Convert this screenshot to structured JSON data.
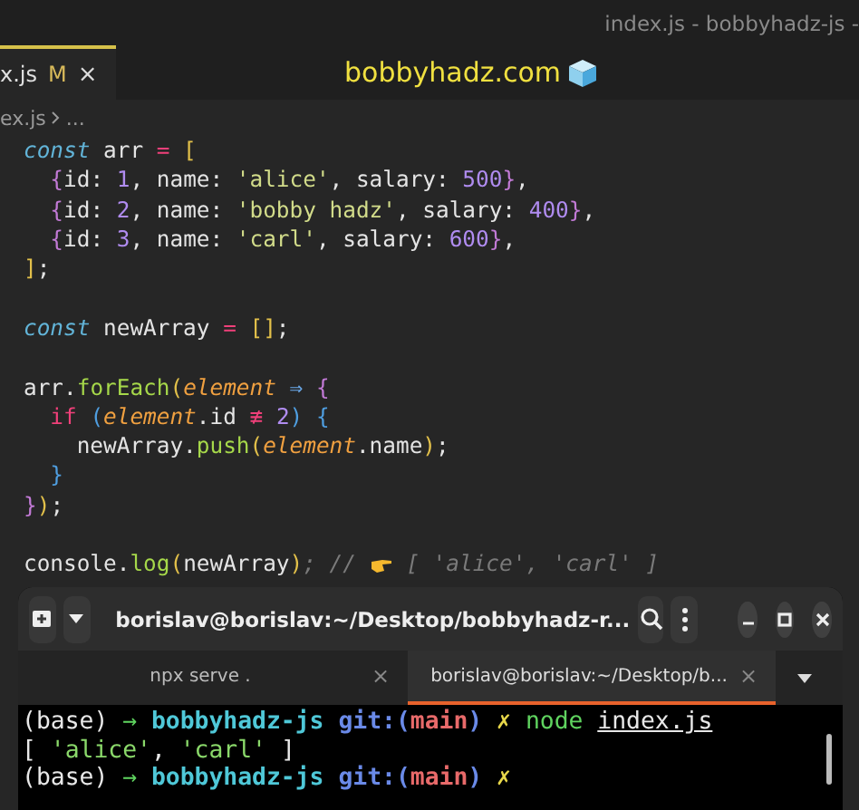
{
  "window": {
    "title": "index.js - bobbyhadz-js -"
  },
  "tabs": [
    {
      "label": "x.js",
      "status": "M",
      "close": "×",
      "selected": true
    }
  ],
  "banner": {
    "text": "bobbyhadz.com"
  },
  "breadcrumb": {
    "file": "ex.js",
    "rest": "..."
  },
  "code": {
    "lines": [
      {
        "kind": "code",
        "tokens": [
          {
            "text": "const",
            "kind": "kw"
          },
          {
            "text": " arr ",
            "kind": "var"
          },
          {
            "text": "=",
            "kind": "op"
          },
          {
            "text": " [",
            "kind": "b1"
          }
        ]
      },
      {
        "kind": "code",
        "tokens": [
          {
            "text": "  {",
            "kind": "b2"
          },
          {
            "text": "id: ",
            "kind": "var"
          },
          {
            "text": "1",
            "kind": "num"
          },
          {
            "text": ", name: ",
            "kind": "var"
          },
          {
            "text": "'alice'",
            "kind": "str"
          },
          {
            "text": ", salary: ",
            "kind": "var"
          },
          {
            "text": "500",
            "kind": "num"
          },
          {
            "text": "}",
            "kind": "b2"
          },
          {
            "text": ",",
            "kind": "var"
          }
        ]
      },
      {
        "kind": "code",
        "tokens": [
          {
            "text": "  {",
            "kind": "b2"
          },
          {
            "text": "id: ",
            "kind": "var"
          },
          {
            "text": "2",
            "kind": "num"
          },
          {
            "text": ", name: ",
            "kind": "var"
          },
          {
            "text": "'bobby hadz'",
            "kind": "str"
          },
          {
            "text": ", salary: ",
            "kind": "var"
          },
          {
            "text": "400",
            "kind": "num"
          },
          {
            "text": "}",
            "kind": "b2"
          },
          {
            "text": ",",
            "kind": "var"
          }
        ]
      },
      {
        "kind": "code",
        "tokens": [
          {
            "text": "  {",
            "kind": "b2"
          },
          {
            "text": "id: ",
            "kind": "var"
          },
          {
            "text": "3",
            "kind": "num"
          },
          {
            "text": ", name: ",
            "kind": "var"
          },
          {
            "text": "'carl'",
            "kind": "str"
          },
          {
            "text": ", salary: ",
            "kind": "var"
          },
          {
            "text": "600",
            "kind": "num"
          },
          {
            "text": "}",
            "kind": "b2"
          },
          {
            "text": ",",
            "kind": "var"
          }
        ]
      },
      {
        "kind": "code",
        "tokens": [
          {
            "text": "]",
            "kind": "b1"
          },
          {
            "text": ";",
            "kind": "var"
          }
        ]
      },
      {
        "kind": "blank"
      },
      {
        "kind": "code",
        "tokens": [
          {
            "text": "const",
            "kind": "kw"
          },
          {
            "text": " newArray ",
            "kind": "var"
          },
          {
            "text": "=",
            "kind": "op"
          },
          {
            "text": " []",
            "kind": "b1"
          },
          {
            "text": ";",
            "kind": "var"
          }
        ]
      },
      {
        "kind": "blank"
      },
      {
        "kind": "code",
        "tokens": [
          {
            "text": "arr.",
            "kind": "var"
          },
          {
            "text": "forEach",
            "kind": "fn"
          },
          {
            "text": "(",
            "kind": "b1"
          },
          {
            "text": "element",
            "kind": "param"
          },
          {
            "text": " ⇒ ",
            "kind": "arrow"
          },
          {
            "text": "{",
            "kind": "b2"
          }
        ]
      },
      {
        "kind": "code",
        "tokens": [
          {
            "text": "  if ",
            "kind": "op"
          },
          {
            "text": "(",
            "kind": "b3"
          },
          {
            "text": "element",
            "kind": "param"
          },
          {
            "text": ".id ",
            "kind": "var"
          },
          {
            "text": "≢",
            "kind": "op"
          },
          {
            "text": " 2",
            "kind": "num"
          },
          {
            "text": ") {",
            "kind": "b3"
          }
        ]
      },
      {
        "kind": "code",
        "tokens": [
          {
            "text": "    newArray.",
            "kind": "var"
          },
          {
            "text": "push",
            "kind": "fn"
          },
          {
            "text": "(",
            "kind": "b1"
          },
          {
            "text": "element",
            "kind": "param"
          },
          {
            "text": ".name",
            "kind": "var"
          },
          {
            "text": ")",
            "kind": "b1"
          },
          {
            "text": ";",
            "kind": "var"
          }
        ]
      },
      {
        "kind": "code",
        "tokens": [
          {
            "text": "  }",
            "kind": "b3"
          }
        ]
      },
      {
        "kind": "code",
        "tokens": [
          {
            "text": "}",
            "kind": "b2"
          },
          {
            "text": ")",
            "kind": "b1"
          },
          {
            "text": ";",
            "kind": "var"
          }
        ]
      },
      {
        "kind": "blank"
      },
      {
        "kind": "code",
        "tokens": [
          {
            "text": "console.",
            "kind": "var"
          },
          {
            "text": "log",
            "kind": "fn"
          },
          {
            "text": "(",
            "kind": "b1"
          },
          {
            "text": "newArray",
            "kind": "var"
          },
          {
            "text": ")",
            "kind": "b1"
          },
          {
            "text": "; // ",
            "kind": "comment"
          },
          {
            "kind": "hand"
          },
          {
            "text": " [ 'alice', 'carl' ]",
            "kind": "comment"
          }
        ]
      }
    ]
  },
  "terminal": {
    "title": "borislav@borislav:~/Desktop/bobbyhadz-r...",
    "tabs": [
      {
        "label": "npx serve .",
        "close": "×",
        "selected": false
      },
      {
        "label": "borislav@borislav:~/Desktop/b...",
        "close": "×",
        "selected": true
      }
    ],
    "lines": [
      [
        {
          "text": "(base) ",
          "kind": "plain"
        },
        {
          "text": "→ ",
          "kind": "green"
        },
        {
          "text": "bobbyhadz-js ",
          "kind": "cyan"
        },
        {
          "text": "git:(",
          "kind": "blue"
        },
        {
          "text": "main",
          "kind": "red"
        },
        {
          "text": ") ",
          "kind": "blue"
        },
        {
          "text": "✗ ",
          "kind": "yellow"
        },
        {
          "text": "node ",
          "kind": "green"
        },
        {
          "text": "index.js",
          "kind": "link"
        }
      ],
      [
        {
          "text": "[ ",
          "kind": "plain"
        },
        {
          "text": "'alice'",
          "kind": "str"
        },
        {
          "text": ", ",
          "kind": "plain"
        },
        {
          "text": "'carl'",
          "kind": "str"
        },
        {
          "text": " ]",
          "kind": "plain"
        }
      ],
      [
        {
          "text": "(base) ",
          "kind": "plain"
        },
        {
          "text": "→ ",
          "kind": "green"
        },
        {
          "text": "bobbyhadz-js ",
          "kind": "cyan"
        },
        {
          "text": "git:(",
          "kind": "blue"
        },
        {
          "text": "main",
          "kind": "red"
        },
        {
          "text": ") ",
          "kind": "blue"
        },
        {
          "text": "✗",
          "kind": "yellow"
        }
      ]
    ]
  }
}
